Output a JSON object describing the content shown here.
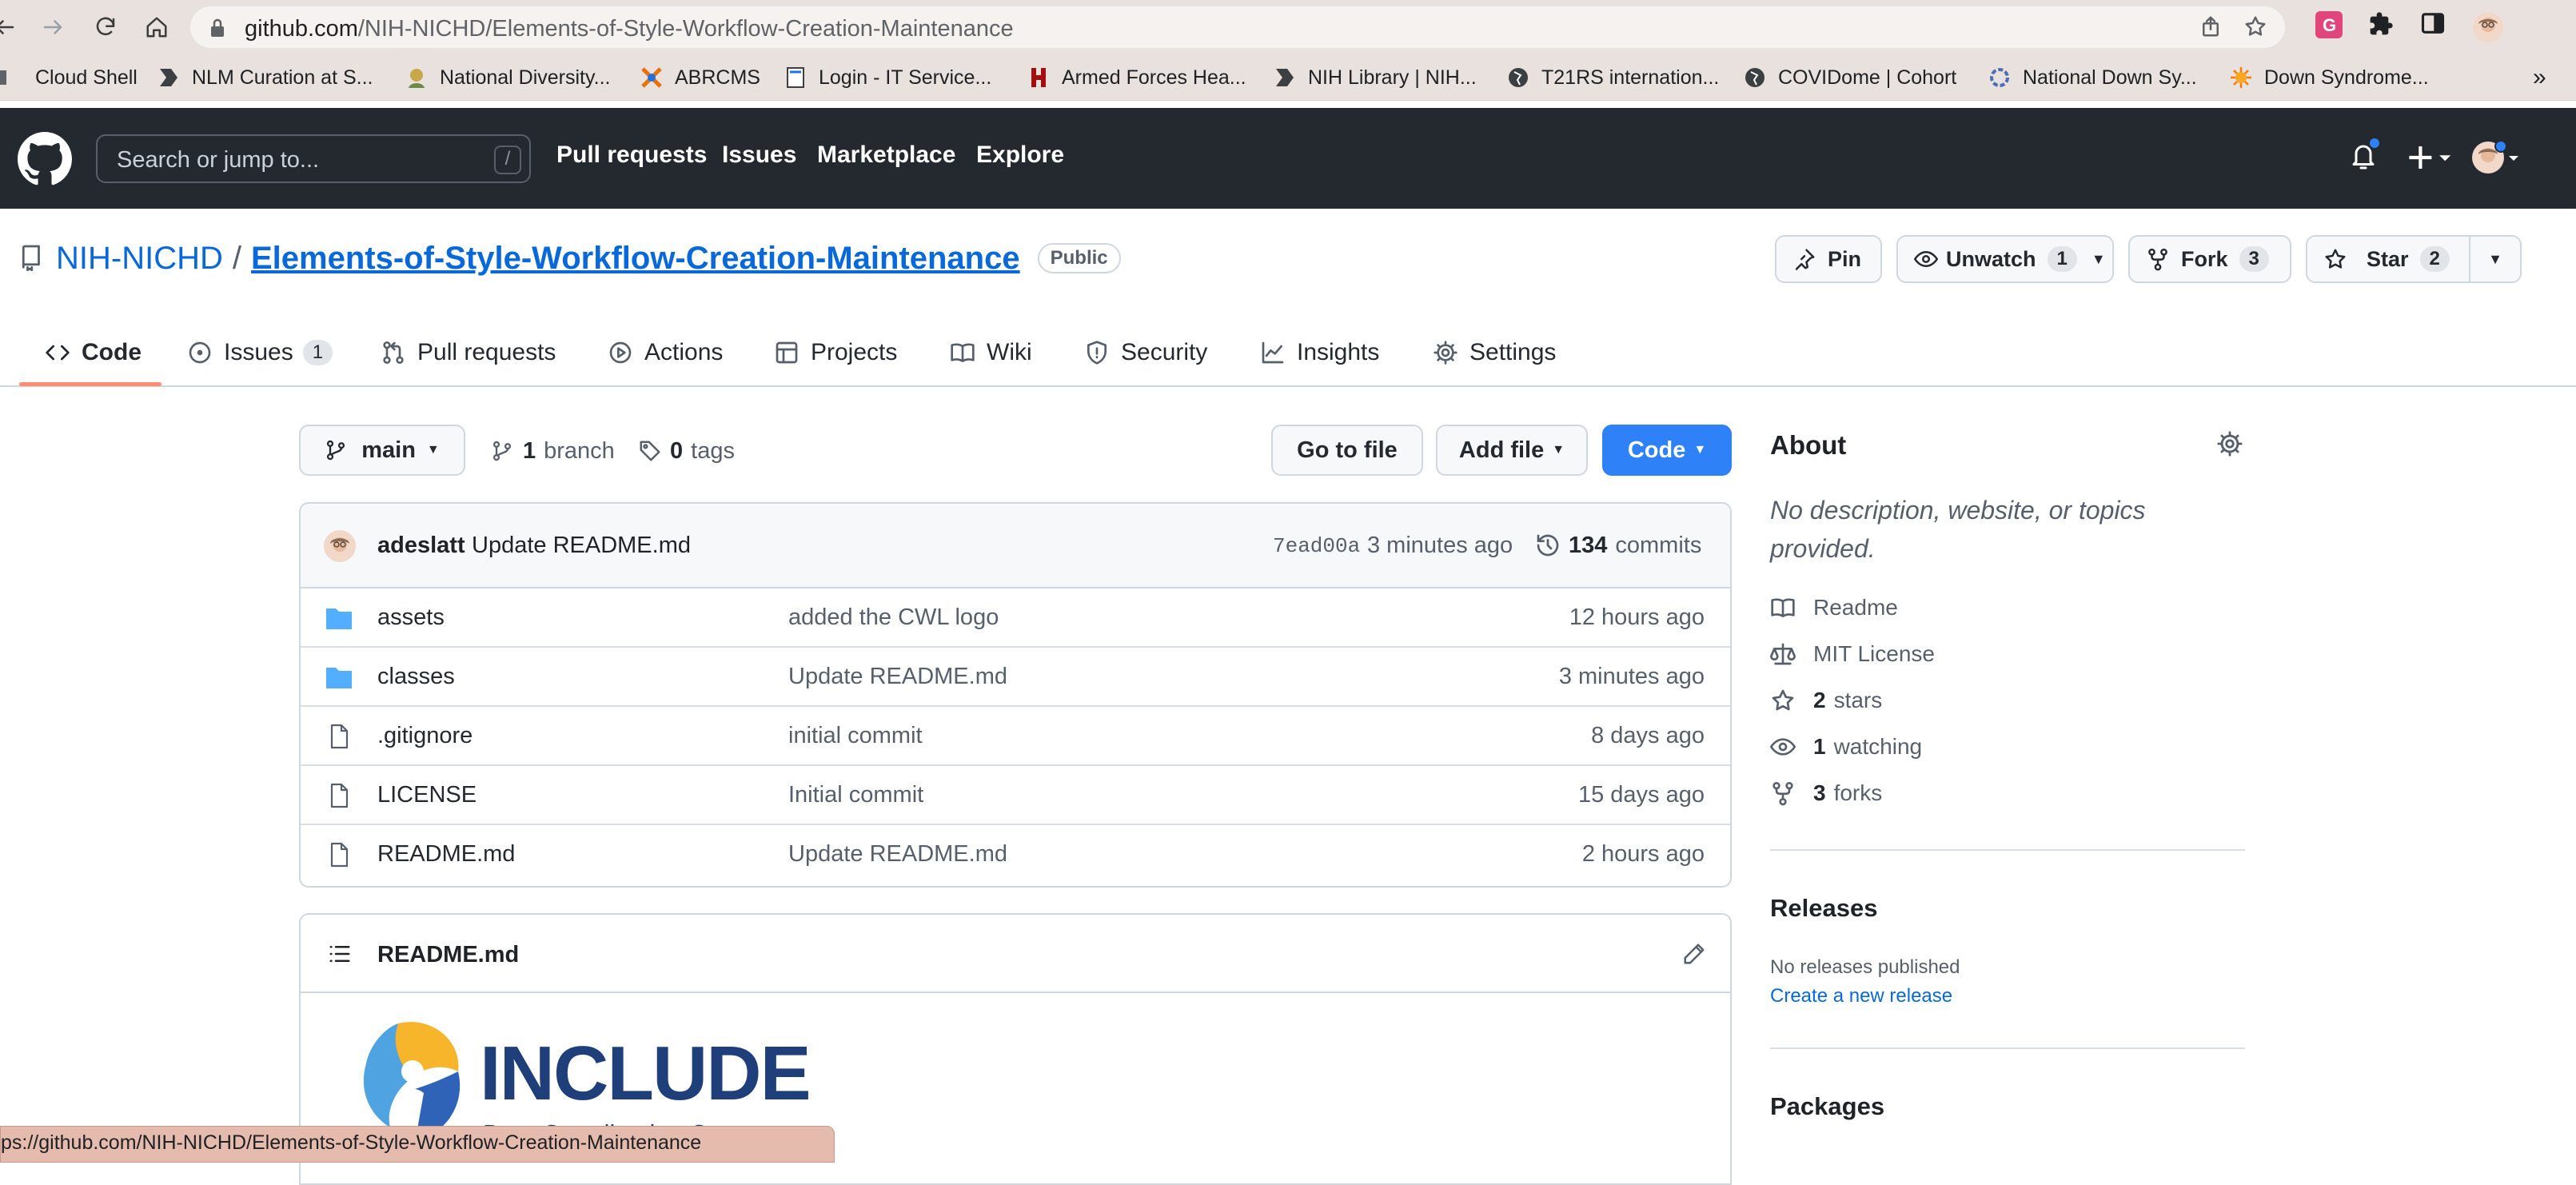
{
  "browser": {
    "url_host": "github.com",
    "url_path": "/NIH-NICHD/Elements-of-Style-Workflow-Creation-Maintenance",
    "bookmarks": [
      "Cloud Shell",
      "NLM Curation at S...",
      "National Diversity...",
      "ABRCMS",
      "Login - IT Service...",
      "Armed Forces Hea...",
      "NIH Library | NIH...",
      "T21RS internation...",
      "COVIDome | Cohort",
      "National Down Sy...",
      "Down Syndrome..."
    ],
    "overflow": "»",
    "status_url": "ps://github.com/NIH-NICHD/Elements-of-Style-Workflow-Creation-Maintenance"
  },
  "github_header": {
    "search_placeholder": "Search or jump to...",
    "search_key": "/",
    "nav": [
      "Pull requests",
      "Issues",
      "Marketplace",
      "Explore"
    ]
  },
  "repo": {
    "owner": "NIH-NICHD",
    "separator": "/",
    "name": "Elements-of-Style-Workflow-Creation-Maintenance",
    "visibility": "Public",
    "pin_label": "Pin",
    "watch_label": "Unwatch",
    "watch_count": "1",
    "fork_label": "Fork",
    "fork_count": "3",
    "star_label": "Star",
    "star_count": "2"
  },
  "tabs": [
    {
      "label": "Code",
      "icon": "code-icon"
    },
    {
      "label": "Issues",
      "icon": "issue-icon",
      "count": "1"
    },
    {
      "label": "Pull requests",
      "icon": "pull-request-icon"
    },
    {
      "label": "Actions",
      "icon": "play-icon"
    },
    {
      "label": "Projects",
      "icon": "table-icon"
    },
    {
      "label": "Wiki",
      "icon": "book-icon"
    },
    {
      "label": "Security",
      "icon": "shield-icon"
    },
    {
      "label": "Insights",
      "icon": "graph-icon"
    },
    {
      "label": "Settings",
      "icon": "gear-icon"
    }
  ],
  "toolbar": {
    "branch": "main",
    "branch_count": "1",
    "branch_word": "branch",
    "tag_count": "0",
    "tag_word": "tags",
    "go_to_file": "Go to file",
    "add_file": "Add file",
    "code": "Code"
  },
  "commit": {
    "author": "adeslatt",
    "message": "Update README.md",
    "sha": "7ead00a",
    "age": "3 minutes ago",
    "count": "134",
    "count_word": "commits"
  },
  "files": [
    {
      "type": "dir",
      "name": "assets",
      "message": "added the CWL logo",
      "age": "12 hours ago"
    },
    {
      "type": "dir",
      "name": "classes",
      "message": "Update README.md",
      "age": "3 minutes ago"
    },
    {
      "type": "file",
      "name": ".gitignore",
      "message": "initial commit",
      "age": "8 days ago"
    },
    {
      "type": "file",
      "name": "LICENSE",
      "message": "Initial commit",
      "age": "15 days ago"
    },
    {
      "type": "file",
      "name": "README.md",
      "message": "Update README.md",
      "age": "2 hours ago"
    }
  ],
  "readme": {
    "title": "README.md",
    "logo_text": "INCLUDE",
    "logo_sub": "Data Coordinating Center"
  },
  "about": {
    "title": "About",
    "description": "No description, website, or topics provided.",
    "readme": "Readme",
    "license": "MIT License",
    "stars_count": "2",
    "stars_word": "stars",
    "watching_count": "1",
    "watching_word": "watching",
    "forks_count": "3",
    "forks_word": "forks"
  },
  "releases": {
    "title": "Releases",
    "none": "No releases published",
    "create": "Create a new release"
  },
  "packages": {
    "title": "Packages"
  },
  "colors": {
    "accent": "#0969da",
    "header_bg": "#24292f",
    "primary_button": "#2f81f7",
    "tab_underline": "#fd8c73"
  }
}
